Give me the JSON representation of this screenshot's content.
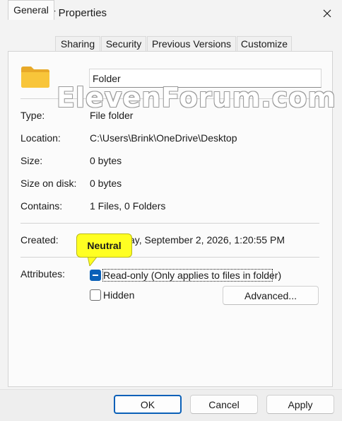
{
  "window": {
    "title": "Folder Properties",
    "icon": "folder-icon",
    "close_icon": "close-icon"
  },
  "tabs": [
    {
      "label": "General",
      "active": true
    },
    {
      "label": "Sharing",
      "active": false
    },
    {
      "label": "Security",
      "active": false
    },
    {
      "label": "Previous Versions",
      "active": false
    },
    {
      "label": "Customize",
      "active": false
    }
  ],
  "general": {
    "folder_name": "Folder",
    "type_label": "Type:",
    "type_value": "File folder",
    "location_label": "Location:",
    "location_value": "C:\\Users\\Brink\\OneDrive\\Desktop",
    "size_label": "Size:",
    "size_value": "0 bytes",
    "size_on_disk_label": "Size on disk:",
    "size_on_disk_value": "0 bytes",
    "contains_label": "Contains:",
    "contains_value": "1 Files, 0 Folders",
    "created_label": "Created:",
    "created_value": "ay, September 2, 2026, 1:20:55 PM",
    "attributes_label": "Attributes:",
    "readonly_label": "Read-only (Only applies to files in folder)",
    "readonly_state": "Neutral",
    "hidden_label": "Hidden",
    "hidden_checked": false,
    "advanced_label": "Advanced..."
  },
  "callout": {
    "text": "Neutral",
    "color": "#ffff22"
  },
  "watermark": "ElevenForum.com",
  "buttons": {
    "ok": "OK",
    "cancel": "Cancel",
    "apply": "Apply"
  },
  "colors": {
    "accent": "#0a60b8",
    "folder": "#f8c53a"
  }
}
